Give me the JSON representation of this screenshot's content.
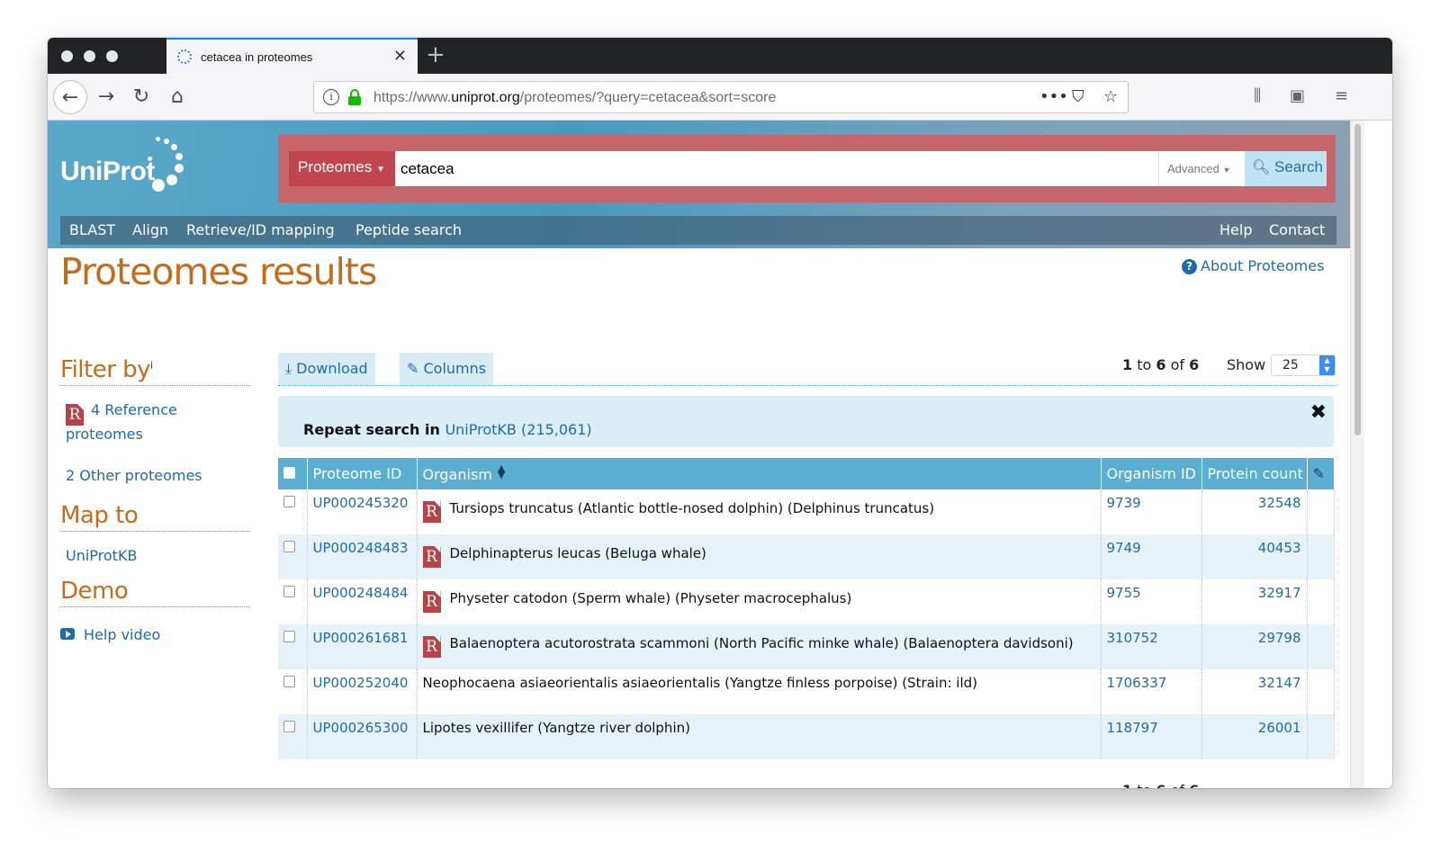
{
  "browser": {
    "tab_title": "cetacea in proteomes",
    "url_prefix": "https://www.",
    "url_domain": "uniprot.org",
    "url_path": "/proteomes/?query=cetacea&sort=score"
  },
  "header": {
    "logo": "UniProt",
    "search_scope": "Proteomes",
    "search_value": "cetacea",
    "advanced_label": "Advanced",
    "search_button": "Search",
    "menu": [
      "BLAST",
      "Align",
      "Retrieve/ID mapping",
      "Peptide search"
    ],
    "menu_right": [
      "Help",
      "Contact"
    ]
  },
  "page": {
    "title": "Proteomes results",
    "about_link": "About Proteomes"
  },
  "sidebar": {
    "filter_heading": "Filter by",
    "filter_sup": "i",
    "reference_line1": "4 Reference",
    "reference_line2": "proteomes",
    "other": "2 Other proteomes",
    "map_heading": "Map to",
    "map_link": "UniProtKB",
    "demo_heading": "Demo",
    "demo_link": "Help video"
  },
  "toolbar": {
    "download": "Download",
    "columns": "Columns",
    "range_from": "1",
    "range_to": "6",
    "range_total": "6",
    "show_label": "Show",
    "show_value": "25"
  },
  "repeat": {
    "label": "Repeat search in",
    "link": "UniProtKB (215,061)"
  },
  "table": {
    "headers": [
      "Proteome ID",
      "Organism",
      "Organism ID",
      "Protein count"
    ],
    "rows": [
      {
        "id": "UP000245320",
        "organism": "Tursiops truncatus (Atlantic bottle-nosed dolphin) (Delphinus truncatus)",
        "reference": true,
        "org_id": "9739",
        "count": "32548"
      },
      {
        "id": "UP000248483",
        "organism": "Delphinapterus leucas (Beluga whale)",
        "reference": true,
        "org_id": "9749",
        "count": "40453"
      },
      {
        "id": "UP000248484",
        "organism": "Physeter catodon (Sperm whale) (Physeter macrocephalus)",
        "reference": true,
        "org_id": "9755",
        "count": "32917"
      },
      {
        "id": "UP000261681",
        "organism": "Balaenoptera acutorostrata scammoni (North Pacific minke whale) (Balaenoptera davidsoni)",
        "reference": true,
        "org_id": "310752",
        "count": "29798"
      },
      {
        "id": "UP000252040",
        "organism": "Neophocaena asiaeorientalis asiaeorientalis (Yangtze finless porpoise) (Strain: ild)",
        "reference": false,
        "org_id": "1706337",
        "count": "32147"
      },
      {
        "id": "UP000265300",
        "organism": "Lipotes vexillifer (Yangtze river dolphin)",
        "reference": false,
        "org_id": "118797",
        "count": "26001"
      }
    ]
  }
}
